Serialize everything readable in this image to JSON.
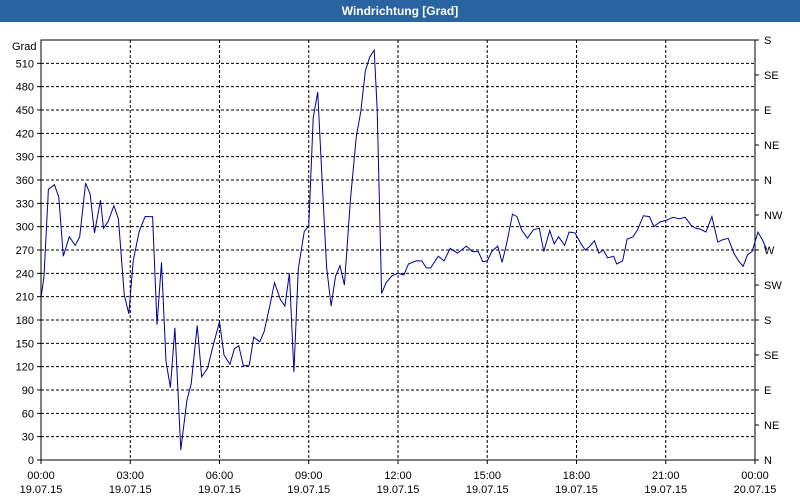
{
  "window": {
    "title": "Windrichtung [Grad]"
  },
  "chart_data": {
    "type": "line",
    "title": "Windrichtung [Grad]",
    "ylabel": "Grad",
    "ylim": [
      0,
      540
    ],
    "yticks": [
      0,
      30,
      60,
      90,
      120,
      150,
      180,
      210,
      240,
      270,
      300,
      330,
      360,
      390,
      420,
      450,
      480,
      510
    ],
    "xlim": [
      0,
      24
    ],
    "xticks": [
      {
        "hours": 0,
        "time": "00:00",
        "date": "19.07.15"
      },
      {
        "hours": 3,
        "time": "03:00",
        "date": "19.07.15"
      },
      {
        "hours": 6,
        "time": "06:00",
        "date": "19.07.15"
      },
      {
        "hours": 9,
        "time": "09:00",
        "date": "19.07.15"
      },
      {
        "hours": 12,
        "time": "12:00",
        "date": "19.07.15"
      },
      {
        "hours": 15,
        "time": "15:00",
        "date": "19.07.15"
      },
      {
        "hours": 18,
        "time": "18:00",
        "date": "19.07.15"
      },
      {
        "hours": 21,
        "time": "21:00",
        "date": "19.07.15"
      },
      {
        "hours": 24,
        "time": "00:00",
        "date": "20.07.15"
      }
    ],
    "y2ticks": [
      {
        "value": 0,
        "label": "N"
      },
      {
        "value": 45,
        "label": "NE"
      },
      {
        "value": 90,
        "label": "E"
      },
      {
        "value": 135,
        "label": "SE"
      },
      {
        "value": 180,
        "label": "S"
      },
      {
        "value": 225,
        "label": "SW"
      },
      {
        "value": 270,
        "label": "W"
      },
      {
        "value": 315,
        "label": "NW"
      },
      {
        "value": 360,
        "label": "N"
      },
      {
        "value": 405,
        "label": "NE"
      },
      {
        "value": 450,
        "label": "E"
      },
      {
        "value": 495,
        "label": "SE"
      },
      {
        "value": 540,
        "label": "S"
      }
    ],
    "grid": true,
    "series": [
      {
        "color": "#000099",
        "points": [
          [
            0.0,
            208
          ],
          [
            0.1,
            236
          ],
          [
            0.25,
            348
          ],
          [
            0.45,
            354
          ],
          [
            0.6,
            338
          ],
          [
            0.75,
            262
          ],
          [
            0.95,
            287
          ],
          [
            1.15,
            276
          ],
          [
            1.3,
            287
          ],
          [
            1.5,
            356
          ],
          [
            1.65,
            342
          ],
          [
            1.8,
            292
          ],
          [
            2.0,
            334
          ],
          [
            2.1,
            298
          ],
          [
            2.25,
            306
          ],
          [
            2.45,
            327
          ],
          [
            2.6,
            310
          ],
          [
            2.8,
            212
          ],
          [
            2.95,
            188
          ],
          [
            3.1,
            256
          ],
          [
            3.3,
            294
          ],
          [
            3.5,
            313
          ],
          [
            3.6,
            313
          ],
          [
            3.75,
            313
          ],
          [
            3.9,
            174
          ],
          [
            4.05,
            254
          ],
          [
            4.2,
            127
          ],
          [
            4.35,
            93
          ],
          [
            4.5,
            170
          ],
          [
            4.7,
            13
          ],
          [
            4.9,
            76
          ],
          [
            5.05,
            98
          ],
          [
            5.25,
            173
          ],
          [
            5.4,
            107
          ],
          [
            5.6,
            118
          ],
          [
            5.75,
            142
          ],
          [
            6.0,
            178
          ],
          [
            6.15,
            135
          ],
          [
            6.35,
            123
          ],
          [
            6.5,
            143
          ],
          [
            6.65,
            147
          ],
          [
            6.8,
            121
          ],
          [
            7.0,
            122
          ],
          [
            7.15,
            158
          ],
          [
            7.35,
            152
          ],
          [
            7.5,
            165
          ],
          [
            7.7,
            200
          ],
          [
            7.85,
            228
          ],
          [
            8.05,
            206
          ],
          [
            8.2,
            198
          ],
          [
            8.35,
            240
          ],
          [
            8.5,
            113
          ],
          [
            8.65,
            246
          ],
          [
            8.85,
            294
          ],
          [
            9.0,
            301
          ],
          [
            9.15,
            440
          ],
          [
            9.3,
            473
          ],
          [
            9.45,
            360
          ],
          [
            9.6,
            248
          ],
          [
            9.75,
            198
          ],
          [
            9.9,
            236
          ],
          [
            10.05,
            250
          ],
          [
            10.2,
            225
          ],
          [
            10.4,
            334
          ],
          [
            10.6,
            416
          ],
          [
            10.75,
            448
          ],
          [
            10.9,
            500
          ],
          [
            11.05,
            518
          ],
          [
            11.2,
            527
          ],
          [
            11.3,
            450
          ],
          [
            11.45,
            214
          ],
          [
            11.6,
            228
          ],
          [
            11.8,
            237
          ],
          [
            12.0,
            240
          ],
          [
            12.2,
            238
          ],
          [
            12.35,
            252
          ],
          [
            12.6,
            256
          ],
          [
            12.8,
            256
          ],
          [
            12.95,
            247
          ],
          [
            13.1,
            247
          ],
          [
            13.35,
            262
          ],
          [
            13.55,
            256
          ],
          [
            13.75,
            272
          ],
          [
            14.0,
            266
          ],
          [
            14.3,
            275
          ],
          [
            14.5,
            268
          ],
          [
            14.7,
            268
          ],
          [
            14.85,
            255
          ],
          [
            15.0,
            256
          ],
          [
            15.15,
            268
          ],
          [
            15.35,
            275
          ],
          [
            15.5,
            254
          ],
          [
            15.65,
            278
          ],
          [
            15.85,
            316
          ],
          [
            16.0,
            313
          ],
          [
            16.15,
            296
          ],
          [
            16.35,
            285
          ],
          [
            16.55,
            296
          ],
          [
            16.75,
            298
          ],
          [
            16.9,
            268
          ],
          [
            17.1,
            295
          ],
          [
            17.25,
            278
          ],
          [
            17.4,
            287
          ],
          [
            17.6,
            276
          ],
          [
            17.75,
            293
          ],
          [
            17.95,
            292
          ],
          [
            18.15,
            278
          ],
          [
            18.3,
            270
          ],
          [
            18.45,
            275
          ],
          [
            18.6,
            282
          ],
          [
            18.75,
            266
          ],
          [
            18.9,
            270
          ],
          [
            19.05,
            260
          ],
          [
            19.25,
            262
          ],
          [
            19.35,
            252
          ],
          [
            19.55,
            256
          ],
          [
            19.7,
            284
          ],
          [
            19.9,
            287
          ],
          [
            20.05,
            296
          ],
          [
            20.25,
            314
          ],
          [
            20.45,
            313
          ],
          [
            20.6,
            300
          ],
          [
            20.8,
            306
          ],
          [
            21.0,
            308
          ],
          [
            21.25,
            312
          ],
          [
            21.45,
            310
          ],
          [
            21.65,
            312
          ],
          [
            21.85,
            302
          ],
          [
            22.0,
            298
          ],
          [
            22.15,
            297
          ],
          [
            22.35,
            293
          ],
          [
            22.55,
            313
          ],
          [
            22.75,
            280
          ],
          [
            22.9,
            283
          ],
          [
            23.1,
            285
          ],
          [
            23.3,
            265
          ],
          [
            23.45,
            256
          ],
          [
            23.6,
            249
          ],
          [
            23.75,
            264
          ],
          [
            23.9,
            268
          ],
          [
            24.1,
            293
          ],
          [
            24.25,
            283
          ],
          [
            24.4,
            270
          ]
        ]
      }
    ]
  }
}
